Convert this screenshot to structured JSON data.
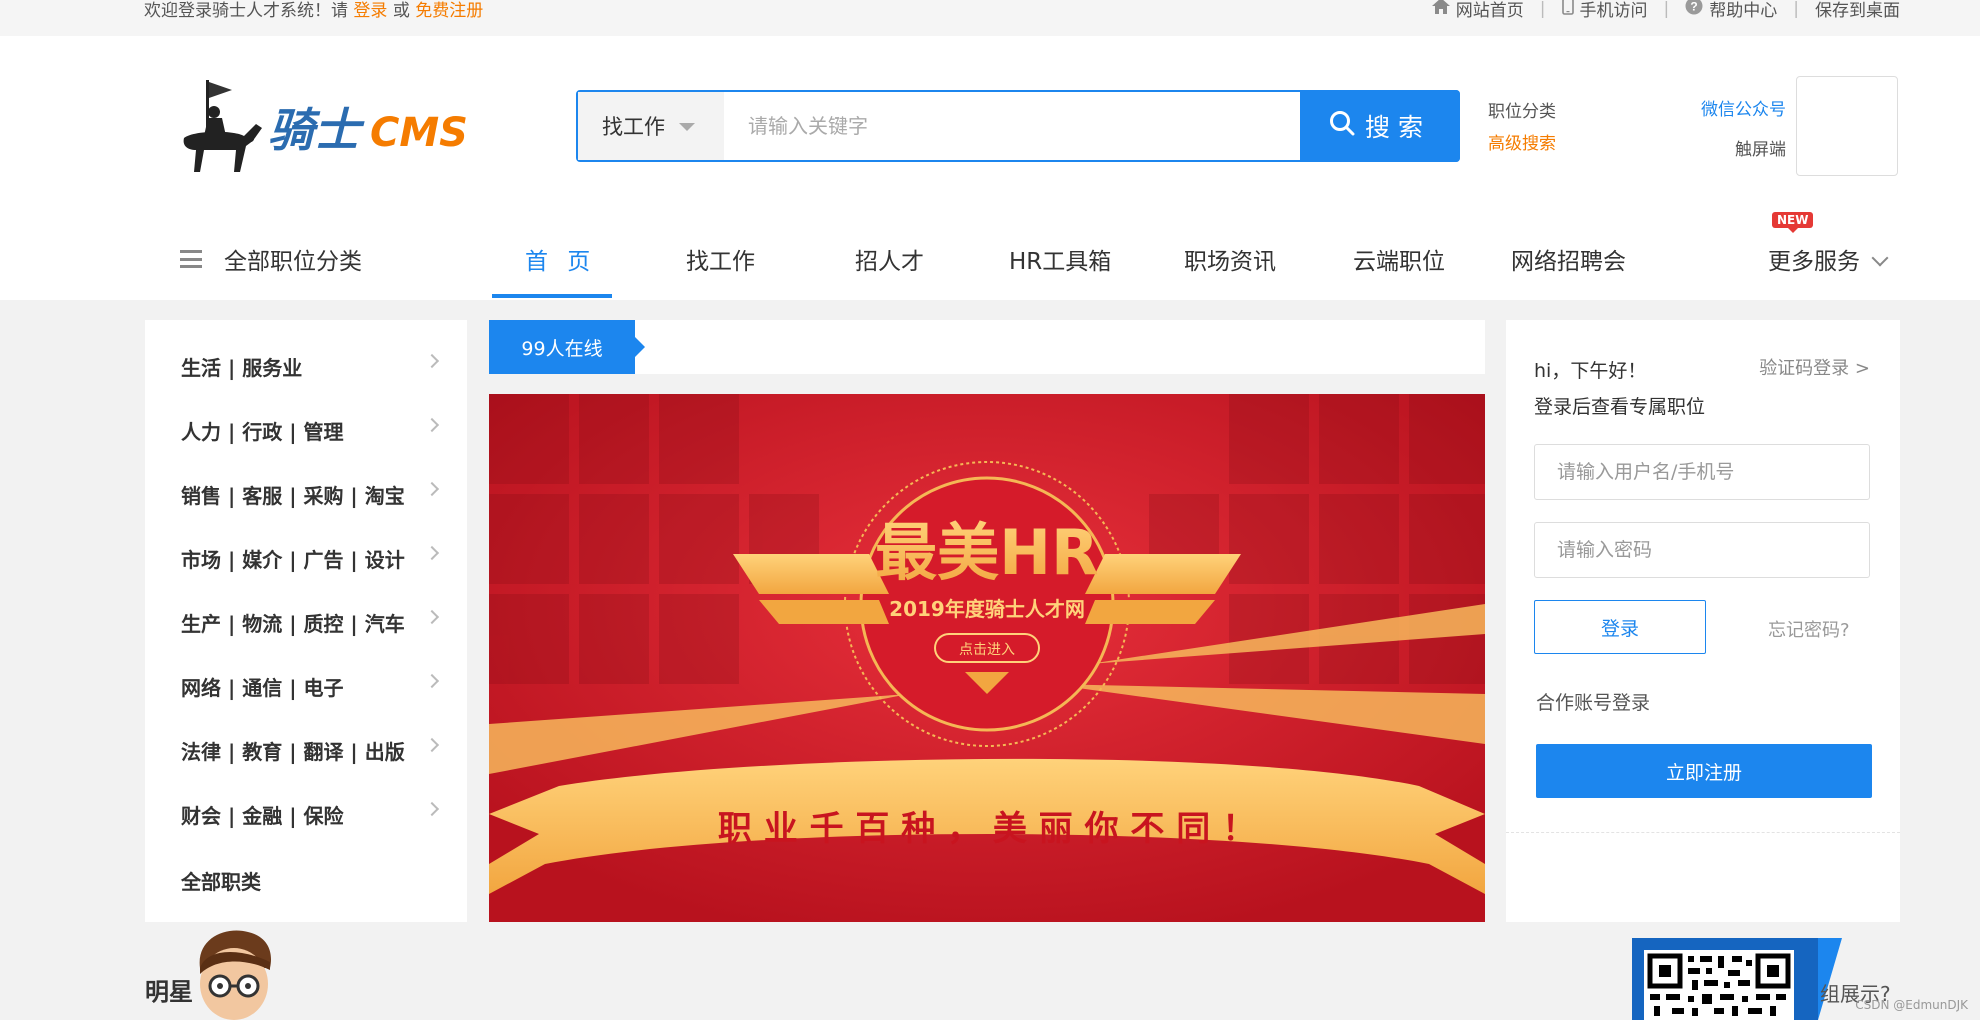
{
  "topbar": {
    "welcome_prefix": "欢迎登录骑士人才系统！请",
    "login_link": "登录",
    "or_text": "或",
    "register_link": "免费注册",
    "links": [
      {
        "label": "网站首页",
        "icon": "home-icon"
      },
      {
        "label": "手机访问",
        "icon": "mobile-icon"
      },
      {
        "label": "帮助中心",
        "icon": "help-icon"
      },
      {
        "label": "保存到桌面",
        "icon": ""
      }
    ]
  },
  "header": {
    "logo_text": "骑士CMS",
    "search": {
      "type_label": "找工作",
      "placeholder": "请输入关键字",
      "button_label": "搜索"
    },
    "links": {
      "category": "职位分类",
      "advanced": "高级搜索",
      "wechat": "微信公众号",
      "touch": "触屏端"
    }
  },
  "nav": {
    "all_categories": "全部职位分类",
    "items": [
      "首 页",
      "找工作",
      "招人才",
      "HR工具箱",
      "职场资讯",
      "云端职位",
      "网络招聘会"
    ],
    "more": "更多服务",
    "new_badge": "NEW"
  },
  "categories": [
    "生活 | 服务业",
    "人力 | 行政 | 管理",
    "销售 | 客服 | 采购 | 淘宝",
    "市场 | 媒介 | 广告 | 设计",
    "生产 | 物流 | 质控 | 汽车",
    "网络 | 通信 | 电子",
    "法律 | 教育 | 翻译 | 出版",
    "财会 | 金融 | 保险",
    "全部职类"
  ],
  "online": "99人在线",
  "banner": {
    "title": "最美HR",
    "subtitle": "2019年度骑士人才网",
    "button": "点击进入",
    "ribbon": "职 业 千 百 种 ， 美 丽 你 不 同 ！"
  },
  "login": {
    "greeting": "hi，下午好！",
    "code_login": "验证码登录 >",
    "subtitle": "登录后查看专属职位",
    "username_placeholder": "请输入用户名/手机号",
    "password_placeholder": "请输入密码",
    "login_button": "登录",
    "forgot": "忘记密码?",
    "coop": "合作账号登录",
    "register_button": "立即注册"
  },
  "bottom": {
    "section_title": "明星",
    "qr_text": "组展示?"
  },
  "watermark": "CSDN @EdmunDJK",
  "colors": {
    "brand_blue": "#1c86ee",
    "accent_orange": "#f57c00",
    "banner_red": "#d51b2a"
  }
}
